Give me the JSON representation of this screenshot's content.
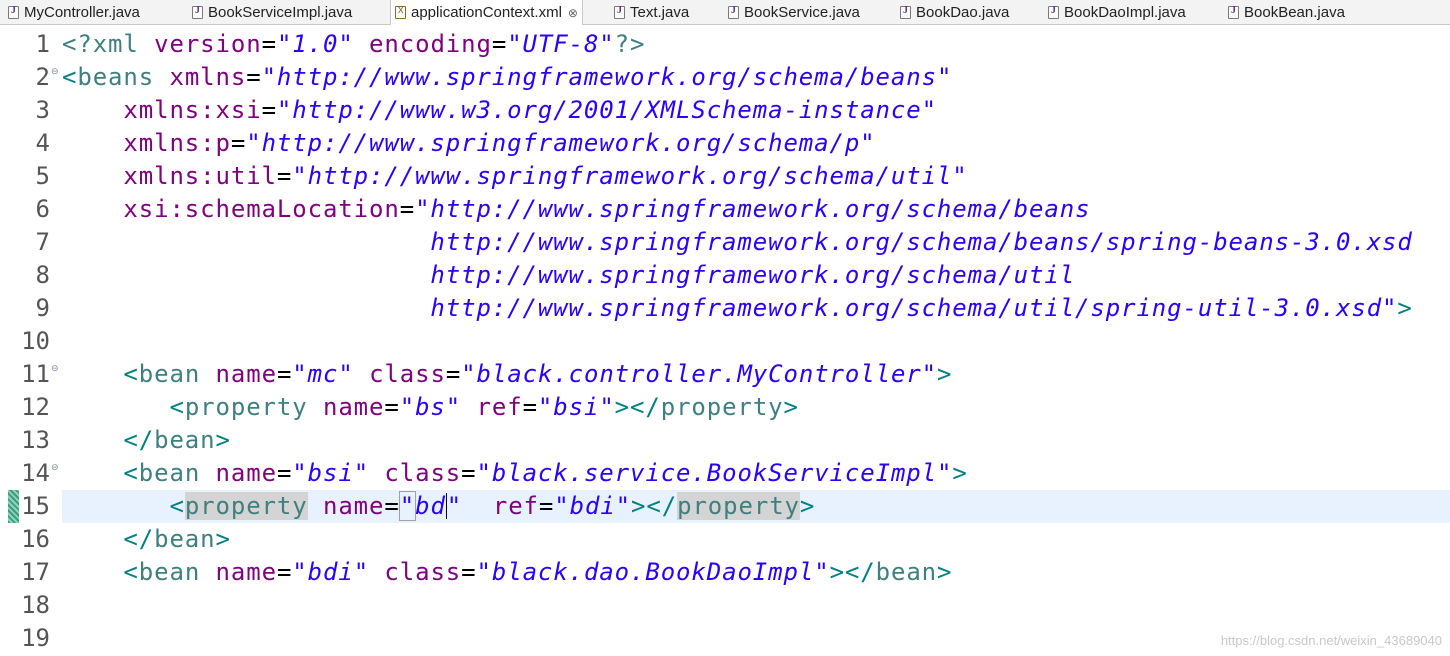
{
  "tabs": [
    {
      "label": "MyController.java",
      "icon": "java-file-icon",
      "active": false
    },
    {
      "label": "BookServiceImpl.java",
      "icon": "java-file-icon",
      "active": false
    },
    {
      "label": "applicationContext.xml",
      "icon": "xml-file-icon",
      "active": true,
      "close": "⊗"
    },
    {
      "label": "Text.java",
      "icon": "java-file-icon",
      "active": false
    },
    {
      "label": "BookService.java",
      "icon": "java-file-icon",
      "active": false
    },
    {
      "label": "BookDao.java",
      "icon": "java-file-icon",
      "active": false
    },
    {
      "label": "BookDaoImpl.java",
      "icon": "java-file-icon",
      "active": false
    },
    {
      "label": "BookBean.java",
      "icon": "java-file-icon",
      "active": false
    }
  ],
  "editor": {
    "line_numbers": [
      "1",
      "2",
      "3",
      "4",
      "5",
      "6",
      "7",
      "8",
      "9",
      "10",
      "11",
      "12",
      "13",
      "14",
      "15",
      "16",
      "17",
      "18",
      "19"
    ],
    "fold_marker": "⊖",
    "current_line": "15",
    "lines": {
      "l1": {
        "open": "<?",
        "name": "xml",
        "a1": "version",
        "v1": "\"1.0\"",
        "a2": "encoding",
        "v2": "\"UTF-8\"",
        "close": "?>"
      },
      "l2": {
        "open": "<",
        "name": "beans",
        "a1": "xmlns",
        "v1": "\"http://www.springframework.org/schema/beans\""
      },
      "l3": {
        "a1": "xmlns:xsi",
        "v1": "\"http://www.w3.org/2001/XMLSchema-instance\""
      },
      "l4": {
        "a1": "xmlns:p",
        "v1": "\"http://www.springframework.org/schema/p\""
      },
      "l5": {
        "a1": "xmlns:util",
        "v1": "\"http://www.springframework.org/schema/util\""
      },
      "l6": {
        "a1": "xsi:schemaLocation",
        "v1": "\"http://www.springframework.org/schema/beans"
      },
      "l7": {
        "v1": "http://www.springframework.org/schema/beans/spring-beans-3.0.xsd"
      },
      "l8": {
        "v1": "http://www.springframework.org/schema/util"
      },
      "l9": {
        "v1": "http://www.springframework.org/schema/util/spring-util-3.0.xsd\"",
        "close": ">"
      },
      "l11": {
        "open": "<",
        "name": "bean",
        "a1": "name",
        "v1": "\"mc\"",
        "a2": "class",
        "v2": "\"black.controller.MyController\"",
        "close": ">"
      },
      "l12": {
        "open": "<",
        "name": "property",
        "a1": "name",
        "v1": "\"bs\"",
        "a2": "ref",
        "v2": "\"bsi\"",
        "mid": "></",
        "name2": "property",
        "close": ">"
      },
      "l13": {
        "open": "</",
        "name": "bean",
        "close": ">"
      },
      "l14": {
        "open": "<",
        "name": "bean",
        "a1": "name",
        "v1": "\"bsi\"",
        "a2": "class",
        "v2": "\"black.service.BookServiceImpl\"",
        "close": ">"
      },
      "l15": {
        "open": "<",
        "name": "property",
        "a1": "name",
        "q1": "\"",
        "v1a": "bd",
        "v1b": "\"",
        "a2": "ref",
        "v2": "\"bdi\"",
        "mid": "></",
        "name2": "property",
        "close": ">"
      },
      "l16": {
        "open": "</",
        "name": "bean",
        "close": ">"
      },
      "l17": {
        "open": "<",
        "name": "bean",
        "a1": "name",
        "v1": "\"bdi\"",
        "a2": "class",
        "v2": "\"black.dao.BookDaoImpl\"",
        "mid": "></",
        "name2": "bean",
        "close": ">"
      }
    }
  },
  "watermark": "https://blog.csdn.net/weixin_43689040"
}
